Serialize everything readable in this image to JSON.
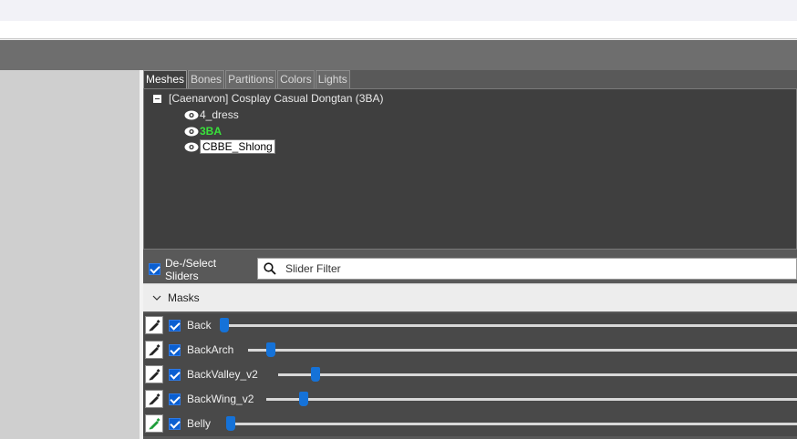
{
  "tabs": [
    {
      "label": "Meshes",
      "active": true
    },
    {
      "label": "Bones",
      "active": false
    },
    {
      "label": "Partitions",
      "active": false
    },
    {
      "label": "Colors",
      "active": false
    },
    {
      "label": "Lights",
      "active": false
    }
  ],
  "tree": {
    "root_label": "[Caenarvon] Cosplay Casual Dongtan (3BA)",
    "children": [
      {
        "label": "4_dress",
        "style": "normal"
      },
      {
        "label": "3BA",
        "style": "green"
      },
      {
        "label": "CBBE_Shlong",
        "style": "selected"
      }
    ]
  },
  "slider_toolbar": {
    "deselect_label": "De-/Select Sliders",
    "filter_placeholder": "Slider Filter"
  },
  "masks": {
    "header_label": "Masks",
    "sliders": [
      {
        "name": "Back",
        "checked": true,
        "pencil_color": "#222222",
        "value_fraction": 0.0
      },
      {
        "name": "BackArch",
        "checked": true,
        "pencil_color": "#222222",
        "value_fraction": 0.04
      },
      {
        "name": "BackValley_v2",
        "checked": true,
        "pencil_color": "#222222",
        "value_fraction": 0.07
      },
      {
        "name": "BackWing_v2",
        "checked": true,
        "pencil_color": "#222222",
        "value_fraction": 0.07
      },
      {
        "name": "Belly",
        "checked": true,
        "pencil_color": "#1f9d3a",
        "value_fraction": 0.0
      }
    ]
  },
  "colors": {
    "accent": "#1572d8",
    "highlight_green": "#39e23b"
  }
}
